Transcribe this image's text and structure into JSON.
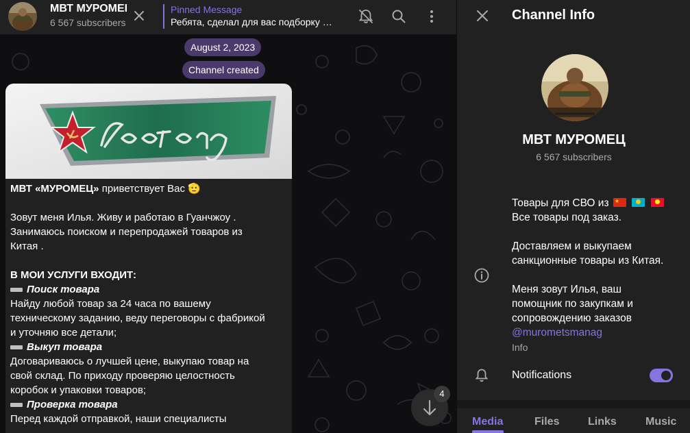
{
  "chat_header": {
    "title": "МВТ МУРОМЕЦ",
    "subscribers": "6 567 subscribers",
    "pinned_title": "Pinned Message",
    "pinned_text": "Ребята, сделал для вас подборку …"
  },
  "service_messages": {
    "date": "August 2, 2023",
    "created": "Channel created"
  },
  "message": {
    "lines": [
      {
        "text": "МВТ «МУРОМЕЦ» приветствует Вас 🫡",
        "style": "greet"
      },
      {
        "text": "",
        "style": "blank"
      },
      {
        "text": "Зовут меня Илья.  Живу и работаю в Гуанчжоу .",
        "style": "normal"
      },
      {
        "text": "Занимаюсь поиском и перепродажей товаров из",
        "style": "normal"
      },
      {
        "text": "Китая .",
        "style": "normal"
      },
      {
        "text": "",
        "style": "blank"
      },
      {
        "text": "В МОИ УСЛУГИ ВХОДИТ:",
        "style": "bold"
      },
      {
        "text": "Поиск товара",
        "style": "heading"
      },
      {
        "text": "Найду любой товар за 24 часа по вашему",
        "style": "normal"
      },
      {
        "text": "техническому заданию, веду переговоры с фабрикой",
        "style": "normal"
      },
      {
        "text": "и уточняю все детали;",
        "style": "normal"
      },
      {
        "text": "Выкуп товара",
        "style": "heading"
      },
      {
        "text": "Договариваюсь о лучшей цене, выкупаю товар на",
        "style": "normal"
      },
      {
        "text": "свой склад. По приходу проверяю целостность",
        "style": "normal"
      },
      {
        "text": "коробок и упаковки товаров;",
        "style": "normal"
      },
      {
        "text": "Проверка товара",
        "style": "heading"
      },
      {
        "text": "Перед каждой отправкой, наши специалисты",
        "style": "normal"
      }
    ]
  },
  "scroll_badge": "4",
  "info_panel": {
    "title": "Channel Info",
    "name": "МВТ МУРОМЕЦ",
    "subscribers": "6 567 subscribers",
    "description": {
      "line1_prefix": "Товары для СВО из",
      "line2": "Все товары под заказ.",
      "line3": "Доставляем и выкупаем",
      "line4": "санкционные товары из Китая.",
      "line5": "Меня зовут Илья, ваш",
      "line6": "помощник по закупкам и",
      "line7": "сопровождению заказов",
      "link": "@murometsmanag"
    },
    "info_label": "Info",
    "notifications_label": "Notifications",
    "notifications_on": true,
    "tabs": [
      "Media",
      "Files",
      "Links",
      "Music"
    ]
  },
  "colors": {
    "accent": "#8774e1",
    "panel": "#212121",
    "chat_bg": "#0f0f11",
    "pill": "#4a3a6b",
    "muted": "#aaaaaa"
  }
}
